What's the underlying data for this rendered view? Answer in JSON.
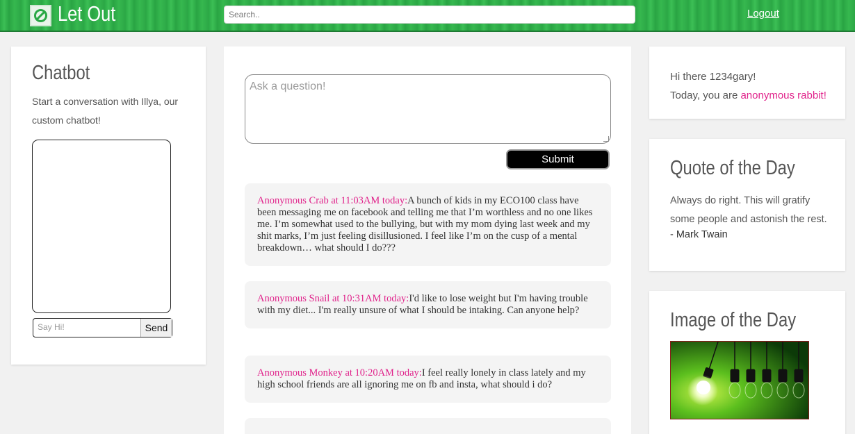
{
  "header": {
    "brand": "Let Out",
    "search_placeholder": "Search..",
    "logout": "Logout"
  },
  "chatbot": {
    "title": "Chatbot",
    "description": "Start a conversation with Illya, our custom chatbot!",
    "input_placeholder": "Say Hi!",
    "send_label": "Send"
  },
  "feed": {
    "ask_placeholder": "Ask a question!",
    "submit_label": "Submit",
    "posts": [
      {
        "meta": "Anonymous Crab at 11:03AM today:",
        "text": "A bunch of kids in my ECO100 class have been messaging me on facebook and telling me that I’m worthless and no one likes me. I’m somewhat used to the bullying, but with my mom dying last week and my shit marks, I’m just feeling disillusioned. I feel like I’m on the cusp of a mental breakdown… what should I do???"
      },
      {
        "meta": "Anonymous Snail at 10:31AM today:",
        "text": "I'd like to lose weight but I'm having trouble with my diet... I'm really unsure of what I should be intaking. Can anyone help?"
      },
      {
        "meta": "Anonymous Monkey at 10:20AM today:",
        "text": "I feel really lonely in class lately and my high school friends are all ignoring me on fb and insta, what should i do?"
      }
    ]
  },
  "greeting": {
    "line1": "Hi there 1234gary!",
    "line2_prefix": "Today, you are ",
    "alias": "anonymous rabbit!"
  },
  "quote": {
    "title": "Quote of the Day",
    "text": "Always do right. This will gratify some people and astonish the rest.",
    "author": "- Mark Twain"
  },
  "image_of_day": {
    "title": "Image of the Day"
  },
  "colors": {
    "accent_green": "#2aa845",
    "highlight_pink": "#e0218a"
  }
}
